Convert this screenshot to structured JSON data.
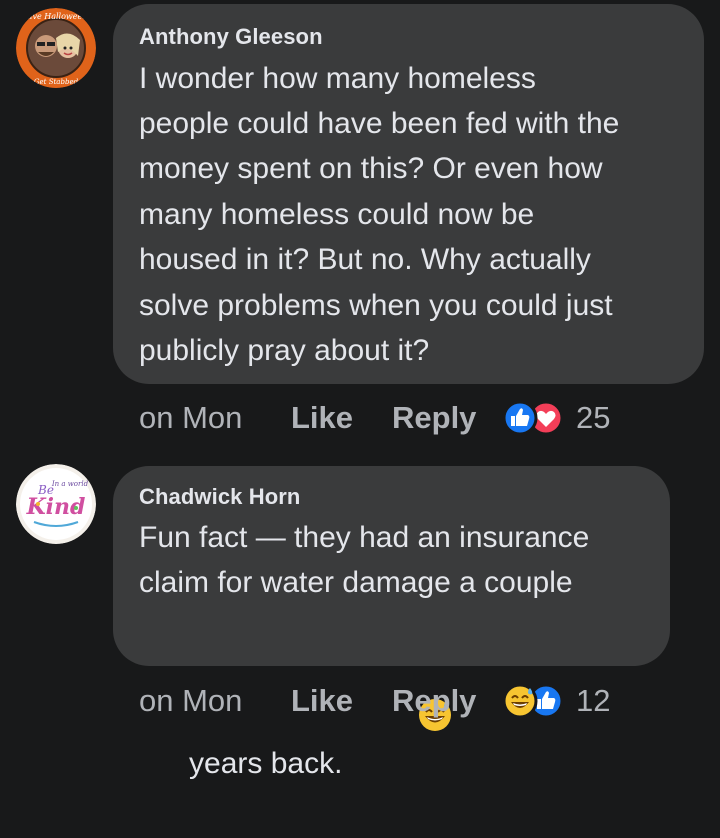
{
  "comments": [
    {
      "author": "Anthony Gleeson",
      "lines": [
        "I wonder how many homeless",
        "people could have been fed with the",
        "money spent on this? Or even how",
        "many homeless could now be",
        "housed in it? But no. Why actually",
        "solve problems when you could just",
        "publicly pray about it?"
      ],
      "avatar_text_top": "Live Halloween",
      "avatar_text_bottom": "Get Stabbed",
      "time": "on Mon",
      "like_label": "Like",
      "reply_label": "Reply",
      "reaction_icons": [
        "like-icon",
        "love-icon"
      ],
      "reaction_count": "25"
    },
    {
      "author": "Chadwick Horn",
      "lines": [
        "Fun fact — they had an insurance",
        "claim for water damage a couple",
        "years back."
      ],
      "inline_emoji": "grinning-sweat-emoji",
      "avatar_text_top": "In a world",
      "avatar_text_main": "Kind",
      "avatar_text_small": "Be",
      "time": "on Mon",
      "like_label": "Like",
      "reply_label": "Reply",
      "reaction_icons": [
        "grinning-sweat-icon",
        "like-icon"
      ],
      "reaction_count": "12"
    }
  ],
  "colors": {
    "background": "#18191a",
    "bubble": "#3a3b3c",
    "text": "#e4e6eb",
    "secondary": "#b0b3b8",
    "like_blue": "#1877f2",
    "love_red": "#f33e58"
  }
}
